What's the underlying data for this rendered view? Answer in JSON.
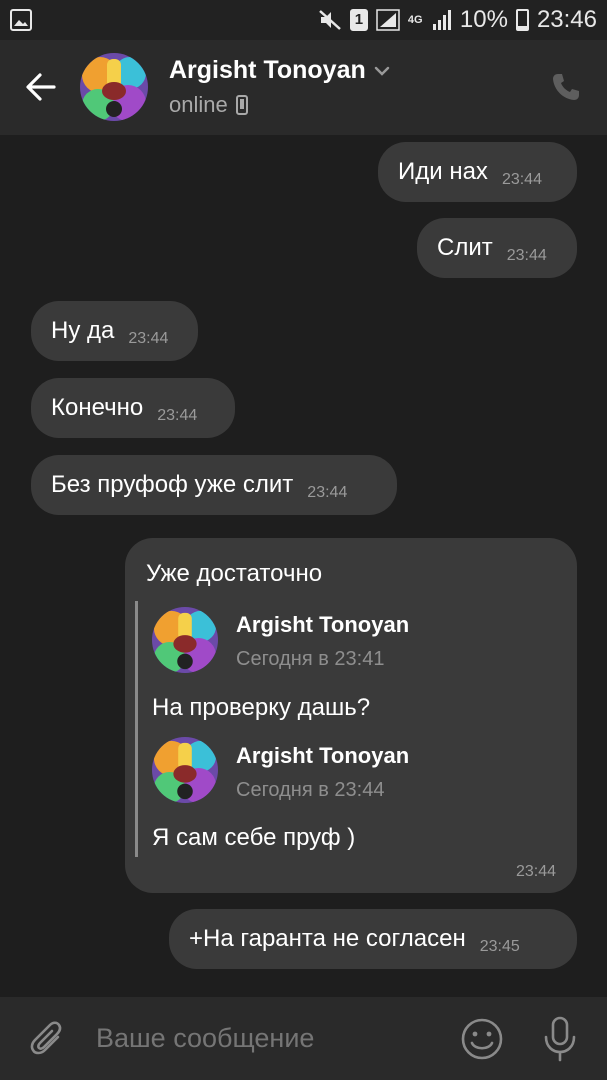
{
  "status_bar": {
    "sim": "1",
    "network": "4G",
    "battery": "10%",
    "battery_level": 0.1,
    "time": "23:46"
  },
  "header": {
    "name": "Argisht Tonoyan",
    "status": "online"
  },
  "messages": [
    {
      "text": "Иди нах",
      "time": "23:44",
      "side": "out"
    },
    {
      "text": "Слит",
      "time": "23:44",
      "side": "out"
    },
    {
      "text": "Ну да",
      "time": "23:44",
      "side": "in"
    },
    {
      "text": "Конечно",
      "time": "23:44",
      "side": "in"
    },
    {
      "text": "Без пруфоф уже слит",
      "time": "23:44",
      "side": "in"
    }
  ],
  "quoted_message": {
    "text": "Уже достаточно",
    "time": "23:44",
    "forwards": [
      {
        "name": "Argisht Tonoyan",
        "date": "Сегодня в 23:41",
        "text": "На проверку дашь?"
      },
      {
        "name": "Argisht Tonoyan",
        "date": "Сегодня в 23:44",
        "text": "Я сам себе пруф )"
      }
    ]
  },
  "last_message": {
    "text": "+На гаранта не согласен",
    "time": "23:45",
    "side": "out"
  },
  "input": {
    "placeholder": "Ваше сообщение"
  },
  "colors": {
    "background": "#1e1e1e",
    "bubble": "#3a3a3a",
    "header": "#2a2a2a"
  }
}
